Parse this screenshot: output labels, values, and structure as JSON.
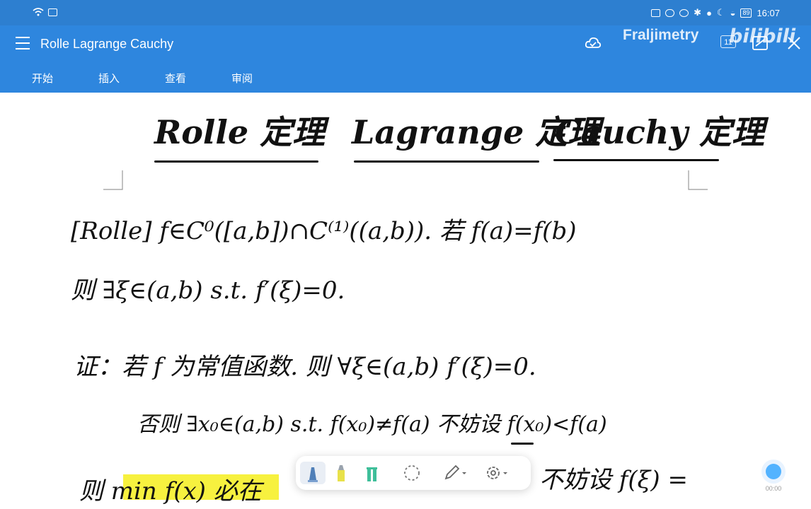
{
  "status_bar": {
    "time": "16:07",
    "battery": "89"
  },
  "header": {
    "menu_icon": "hamburger-menu-icon",
    "title": "Rolle Lagrange Cauchy",
    "tabs": [
      "开始",
      "插入",
      "查看",
      "审阅"
    ],
    "watermark_name": "Fraljimetry",
    "watermark_logo": "bilibili",
    "right_badge": "11"
  },
  "note": {
    "title_parts": [
      "Rolle 定理",
      "Lagrange 定理",
      "Cauchy 定理"
    ],
    "lines": [
      "[Rolle]  f∈C⁰([a,b])∩C⁽¹⁾((a,b)).  若 f(a)=f(b)",
      "则 ∃ξ∈(a,b)    s.t. f′(ξ)=0.",
      "证：若 f 为常值函数.  则 ∀ξ∈(a,b)   f′(ξ)=0.",
      "否则 ∃x₀∈(a,b)   s.t.  f(x₀)≠f(a)   不妨设 f(x₀)<f(a)",
      "则   min f(x)  必在",
      "不妨设 f(ξ) ="
    ]
  },
  "toolbar": {
    "tools": [
      "pen-blue-icon",
      "highlighter-yellow-icon",
      "highlighter-green-icon",
      "lasso-icon",
      "pencil-dropdown-icon",
      "settings-dropdown-icon"
    ]
  },
  "fab": {
    "label": "00:00"
  },
  "colors": {
    "status_bar": "#2d7fd0",
    "app_bar": "#2e86de",
    "highlight": "#f6f02a",
    "ink": "#111111"
  }
}
